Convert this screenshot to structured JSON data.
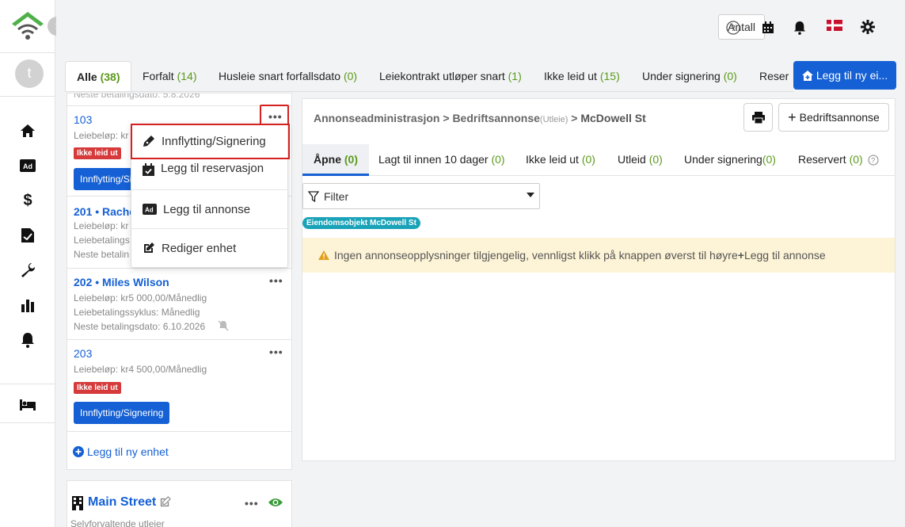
{
  "sidebar": {
    "avatar_initial": "t",
    "collapse_glyph": "›"
  },
  "topbar": {
    "antall_label": "Antall",
    "icons": [
      "help-icon",
      "calendar-icon",
      "bell-icon",
      "flag-icon",
      "gear-icon"
    ]
  },
  "tabs": [
    {
      "label": "Alle",
      "count": "(38)"
    },
    {
      "label": "Forfalt",
      "count": "(14)"
    },
    {
      "label": "Husleie snart forfallsdato",
      "count": "(0)"
    },
    {
      "label": "Leiekontrakt utløper snart",
      "count": "(1)"
    },
    {
      "label": "Ikke leid ut",
      "count": "(15)"
    },
    {
      "label": "Under signering",
      "count": "(0)"
    },
    {
      "label": "Reser",
      "count": ""
    }
  ],
  "add_new_label": "Legg til ny ei...",
  "units": {
    "partial_top": "Neste betalingsdato: 5.8.2026",
    "u103": {
      "title": "103",
      "line1": "Leiebeløp: kr",
      "badge": "Ikke leid ut",
      "button": "Innflytting/Signering"
    },
    "u201": {
      "title": "201 • Rache",
      "line1": "Leiebeløp: kr",
      "line2": "Leiebetalings",
      "line3": "Neste betalin"
    },
    "u202": {
      "title": "202 • Miles Wilson",
      "line1": "Leiebeløp: kr5 000,00/Månedlig",
      "line2": "Leiebetalingssyklus: Månedlig",
      "line3": "Neste betalingsdato:  6.10.2026"
    },
    "u203": {
      "title": "203",
      "line1": "Leiebeløp: kr4 500,00/Månedlig",
      "badge": "Ikke leid ut",
      "button": "Innflytting/Signering"
    },
    "add_unit": "Legg til ny enhet",
    "dots": "•••"
  },
  "dropdown": [
    {
      "label": "Innflytting/Signering"
    },
    {
      "label": "Legg til reservasjon"
    },
    {
      "label": "Legg til annonse"
    },
    {
      "label": "Rediger enhet"
    }
  ],
  "main": {
    "crumb1": "Annonseadministrasjon",
    "sep": ">",
    "crumb2": "Bedriftsannonse",
    "crumb2_small": "(Utleie)",
    "crumb3": "McDowell St",
    "bedrift_btn": "Bedriftsannonse",
    "sub_tabs": [
      {
        "label": "Åpne",
        "count": "(0)"
      },
      {
        "label": "Lagt til innen 10 dager",
        "count": "(0)"
      },
      {
        "label": "Ikke leid ut",
        "count": "(0)"
      },
      {
        "label": "Utleid",
        "count": "(0)"
      },
      {
        "label": "Under signering",
        "count": "(0)"
      },
      {
        "label": "Reservert",
        "count": "(0)"
      }
    ],
    "filter_label": "Filter",
    "property_badge": "Eiendomsobjekt McDowell St",
    "warning_text": "Ingen annonseopplysninger tilgjengelig, vennligst klikk på knappen øverst til høyre",
    "warning_link": "Legg til annonse"
  },
  "property2": {
    "title": "Main Street",
    "subtitle": "Selvforvaltende utleier"
  },
  "colors": {
    "primary": "#1560d4",
    "count_green": "#5a9a1a",
    "danger": "#d63a3a",
    "teal": "#1aa3b8",
    "warning_bg": "#fdf3d6"
  }
}
